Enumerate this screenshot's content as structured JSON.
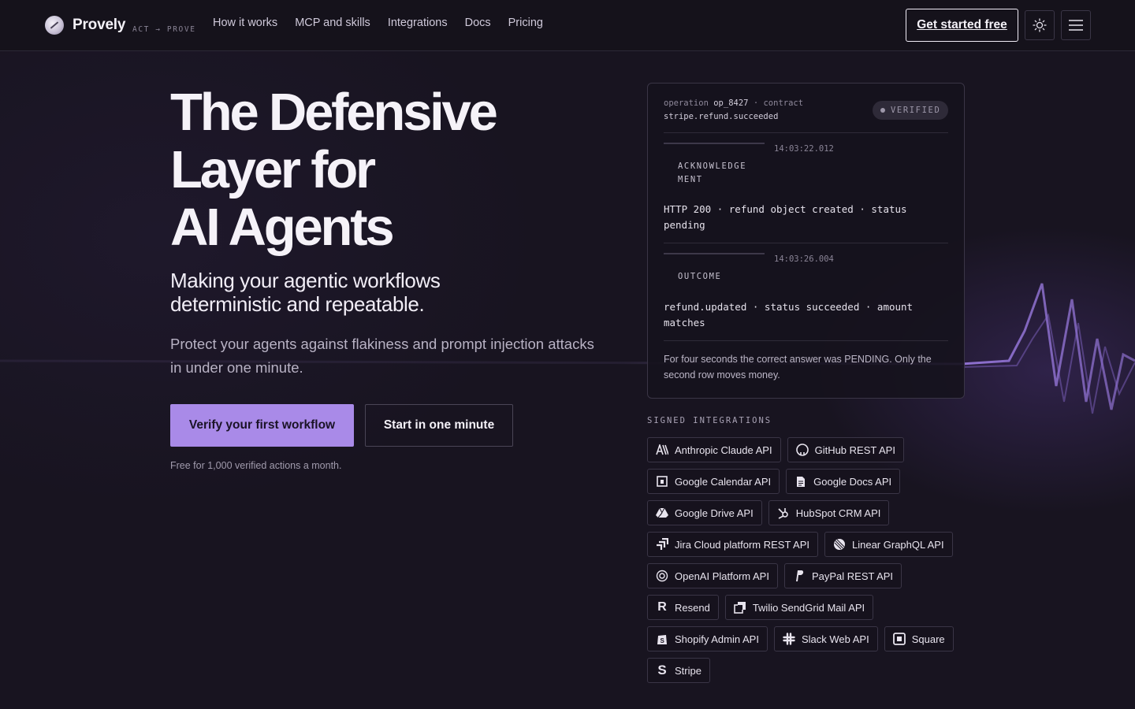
{
  "header": {
    "brand": "Provely",
    "tagline": "ACT → PROVE",
    "nav": [
      "How it works",
      "MCP and skills",
      "Integrations",
      "Docs",
      "Pricing"
    ],
    "cta": "Get started free"
  },
  "hero": {
    "title_lines": [
      "The Defensive",
      "Layer for",
      "AI Agents"
    ],
    "subtitle": "Making your agentic workflows deterministic and repeatable.",
    "description": "Protect your agents against flakiness and prompt injection attacks in under one minute.",
    "primary_button": "Verify your first workflow",
    "secondary_button": "Start in one minute",
    "fine_print": "Free for 1,000 verified actions a month."
  },
  "operation": {
    "label_operation": "operation",
    "id": "op_8427",
    "label_contract": "contract",
    "contract": "stripe.refund.succeeded",
    "badge": "VERIFIED",
    "steps": [
      {
        "time": "14:03:22.012",
        "label_lines": [
          "ACKNOWLEDGE",
          "MENT"
        ],
        "text": "HTTP 200 · refund object created · status pending"
      },
      {
        "time": "14:03:26.004",
        "label_lines": [
          "OUTCOME"
        ],
        "text": "refund.updated · status succeeded · amount matches"
      }
    ],
    "note": "For four seconds the correct answer was PENDING. Only the second row moves money."
  },
  "integrations": {
    "title": "SIGNED INTEGRATIONS",
    "rows": [
      [
        {
          "label": "Anthropic Claude API",
          "icon": "anthropic-icon"
        },
        {
          "label": "GitHub REST API",
          "icon": "github-icon"
        }
      ],
      [
        {
          "label": "Google Calendar API",
          "icon": "calendar-icon"
        },
        {
          "label": "Google Docs API",
          "icon": "docs-icon"
        }
      ],
      [
        {
          "label": "Google Drive API",
          "icon": "drive-icon"
        },
        {
          "label": "HubSpot CRM API",
          "icon": "hubspot-icon"
        }
      ],
      [
        {
          "label": "Jira Cloud platform REST API",
          "icon": "jira-icon"
        },
        {
          "label": "Linear GraphQL API",
          "icon": "linear-icon"
        }
      ],
      [
        {
          "label": "OpenAI Platform API",
          "icon": "openai-icon"
        },
        {
          "label": "PayPal REST API",
          "icon": "paypal-icon"
        }
      ],
      [
        {
          "label": "Resend",
          "icon": "resend-icon"
        },
        {
          "label": "Twilio SendGrid Mail API",
          "icon": "sendgrid-icon"
        }
      ],
      [
        {
          "label": "Shopify Admin API",
          "icon": "shopify-icon"
        },
        {
          "label": "Slack Web API",
          "icon": "slack-icon"
        },
        {
          "label": "Square",
          "icon": "square-icon"
        }
      ],
      [
        {
          "label": "Stripe",
          "icon": "stripe-icon"
        }
      ]
    ]
  },
  "colors": {
    "background": "#181420",
    "accent": "#a98ae8",
    "text": "#ece8f2"
  }
}
